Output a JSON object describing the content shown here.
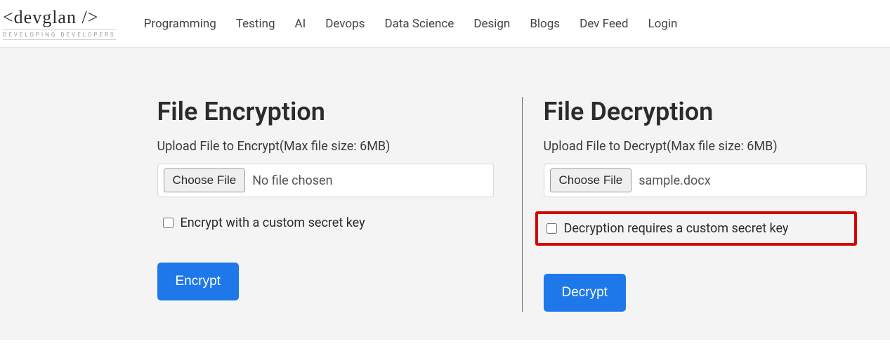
{
  "logo": {
    "top": "<devglan />",
    "bottom": "DEVELOPING DEVELOPERS"
  },
  "nav": {
    "programming": "Programming",
    "testing": "Testing",
    "ai": "AI",
    "devops": "Devops",
    "data_science": "Data Science",
    "design": "Design",
    "blogs": "Blogs",
    "dev_feed": "Dev Feed",
    "login": "Login"
  },
  "encrypt": {
    "title": "File Encryption",
    "upload_label": "Upload File to Encrypt(Max file size: 6MB)",
    "choose_label": "Choose File",
    "file_status": "No file chosen",
    "checkbox_label": "Encrypt with a custom secret key",
    "button": "Encrypt"
  },
  "decrypt": {
    "title": "File Decryption",
    "upload_label": "Upload File to Decrypt(Max file size: 6MB)",
    "choose_label": "Choose File",
    "file_status": "sample.docx",
    "checkbox_label": "Decryption requires a custom secret key",
    "button": "Decrypt"
  }
}
